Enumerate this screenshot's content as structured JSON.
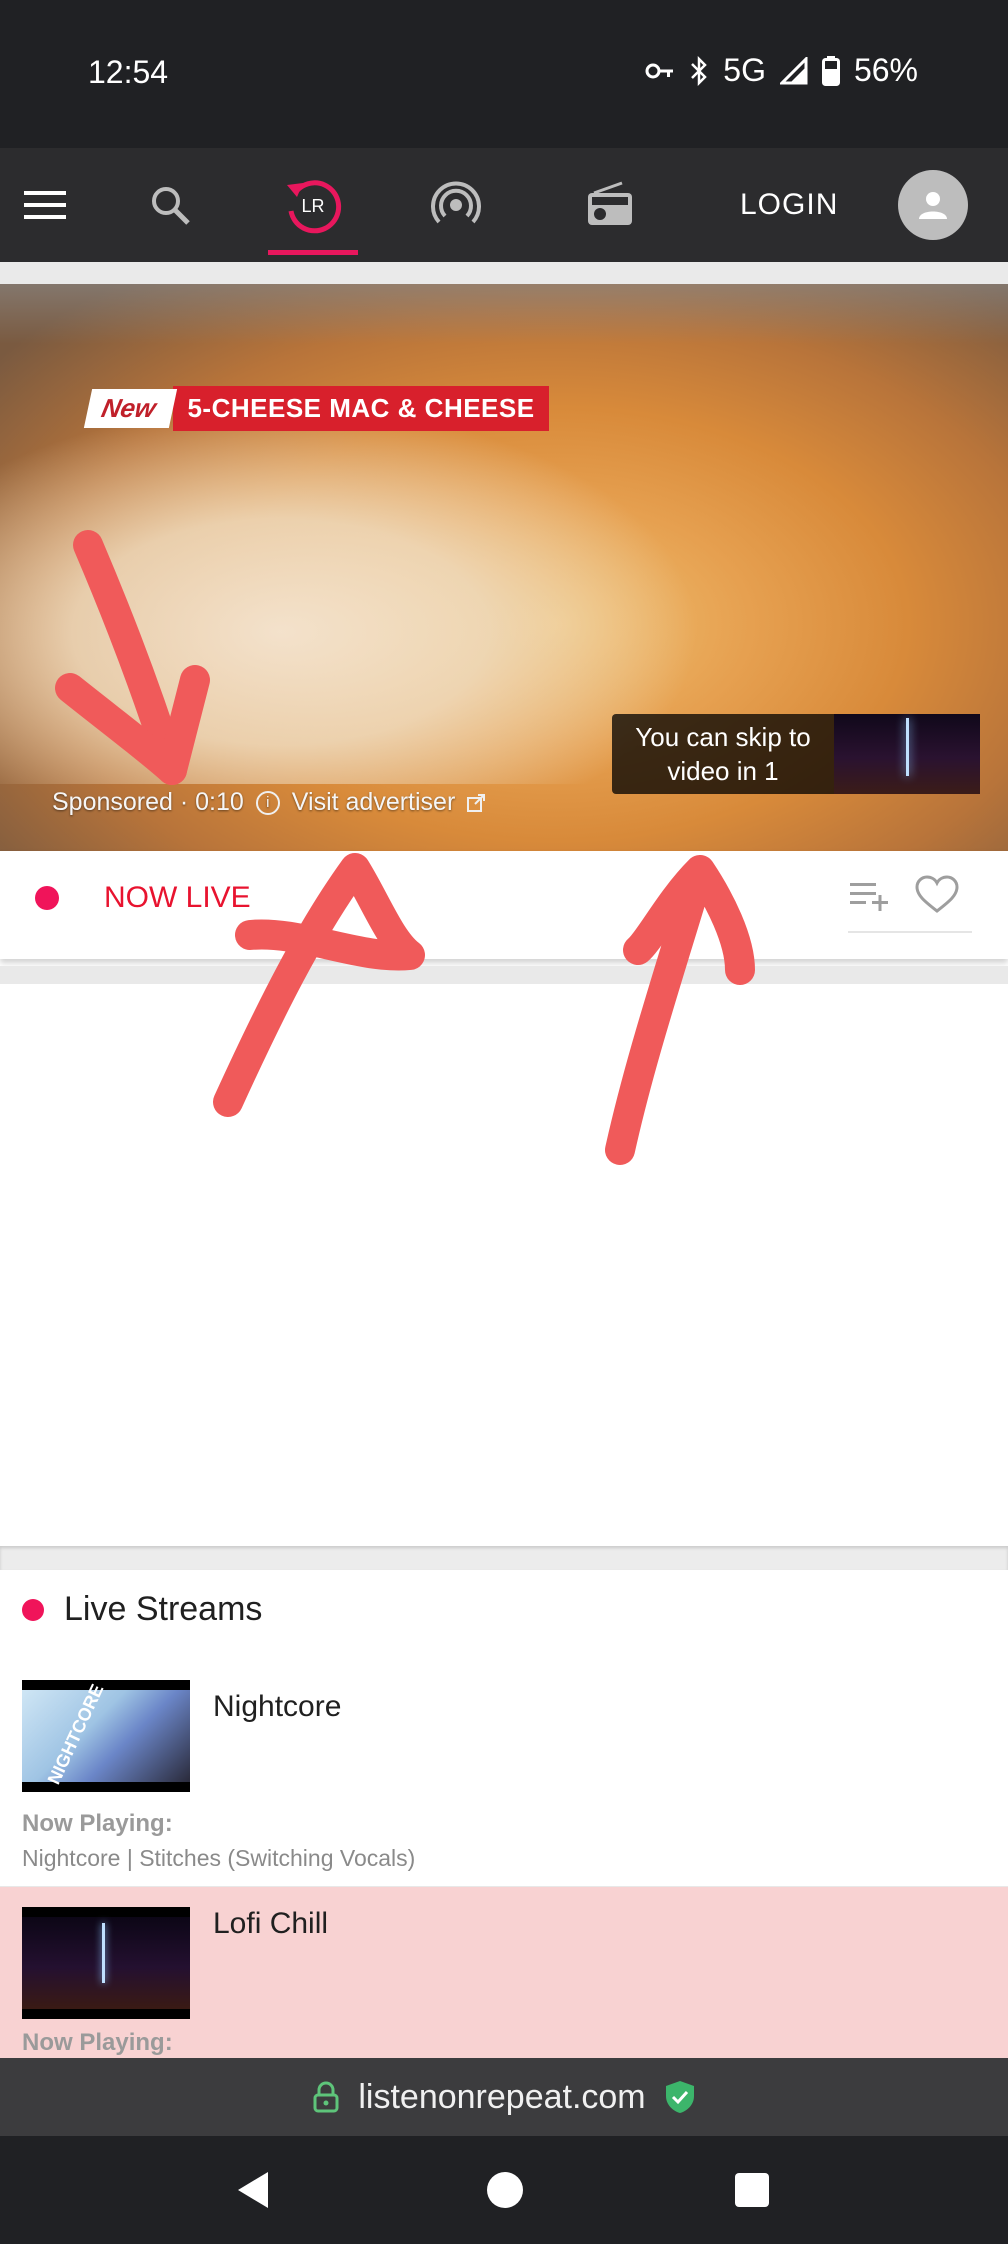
{
  "status_bar": {
    "time": "12:54",
    "network": "5G",
    "battery": "56%"
  },
  "nav": {
    "menu_icon": "menu-icon",
    "search_icon": "search-icon",
    "replay_label": "LR",
    "podcast_icon": "podcast-icon",
    "radio_icon": "radio-icon",
    "login_label": "LOGIN",
    "accent": "#e8175d"
  },
  "ad": {
    "new_label": "New",
    "title": "5-CHEESE MAC & CHEESE",
    "sponsored": "Sponsored · 0:10",
    "visit": "Visit advertiser",
    "skip_text": "You can skip to video in 1"
  },
  "player": {
    "now_live": "NOW LIVE"
  },
  "streams": {
    "header": "Live Streams",
    "items": [
      {
        "title": "Nightcore",
        "now_playing_label": "Now Playing:",
        "song": "Nightcore | Stitches (Switching Vocals)",
        "thumb_text": "NIGHTCORE"
      },
      {
        "title": "Lofi Chill",
        "now_playing_label": "Now Playing:"
      }
    ]
  },
  "url_bar": {
    "url": "listenonrepeat.com"
  }
}
